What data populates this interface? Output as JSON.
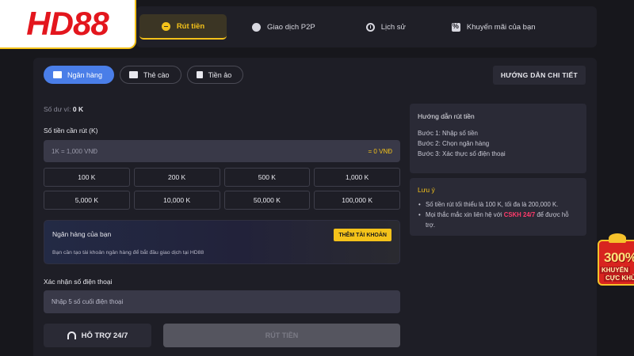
{
  "brand": {
    "logo_hd": "HD",
    "logo_88": "88",
    "color": "#e3161d"
  },
  "nav": {
    "tabs": [
      {
        "label": "Rút tiền",
        "icon": "withdraw-icon",
        "active": true
      },
      {
        "label": "Giao dịch P2P",
        "icon": "p2p-icon",
        "active": false
      },
      {
        "label": "Lịch sử",
        "icon": "clock-icon",
        "active": false
      },
      {
        "label": "Khuyến mãi của bạn",
        "icon": "promo-icon",
        "active": false
      }
    ]
  },
  "methods": [
    {
      "label": "Ngân hàng",
      "icon": "bank-icon",
      "active": true
    },
    {
      "label": "Thẻ cào",
      "icon": "card-icon",
      "active": false
    },
    {
      "label": "Tiền ảo",
      "icon": "crypto-icon",
      "active": false
    }
  ],
  "guide_button": "HƯỚNG DẪN CHI TIẾT",
  "balance": {
    "label": "Số dư ví:",
    "value": "0 K"
  },
  "amount": {
    "label": "Số tiền cần rút (K)",
    "placeholder": "1K = 1,000 VNĐ",
    "converted": "= 0 VNĐ",
    "options": [
      "100 K",
      "200 K",
      "500 K",
      "1,000 K",
      "5,000 K",
      "10,000 K",
      "50,000 K",
      "100,000 K"
    ]
  },
  "bank_card": {
    "title": "Ngân hàng của bạn",
    "add_button": "THÊM TÀI KHOẢN",
    "description": "Bạn cần tạo tài khoản ngân hàng để bắt đầu giao dịch tại HD88"
  },
  "phone": {
    "label": "Xác nhận số điện thoại",
    "placeholder": "Nhập 5 số cuối điện thoại"
  },
  "actions": {
    "support": "HỖ TRỢ 24/7",
    "withdraw": "RÚT TIỀN"
  },
  "guide_card": {
    "title": "Hướng dẫn rút tiền",
    "steps": [
      "Bước 1: Nhập số tiền",
      "Bước 2: Chọn ngân hàng",
      "Bước 3: Xác thực số điện thoại"
    ]
  },
  "note_card": {
    "title": "Lưu ý",
    "item1": "Số tiền rút tối thiểu là 100 K, tối đa là 200,000 K.",
    "item2_pre": "Mọi thắc mắc xin liên hệ với ",
    "item2_highlight": "CSKH 24/7",
    "item2_post": " để được hỗ trợ."
  },
  "promo_badge": {
    "percent": "300%",
    "line1": "KHUYẾN",
    "line2": "CỰC KHỦ"
  },
  "colors": {
    "accent": "#f4c21a",
    "primary_blue": "#4a7ee8",
    "highlight": "#ff3b6b",
    "background": "#17171c"
  }
}
